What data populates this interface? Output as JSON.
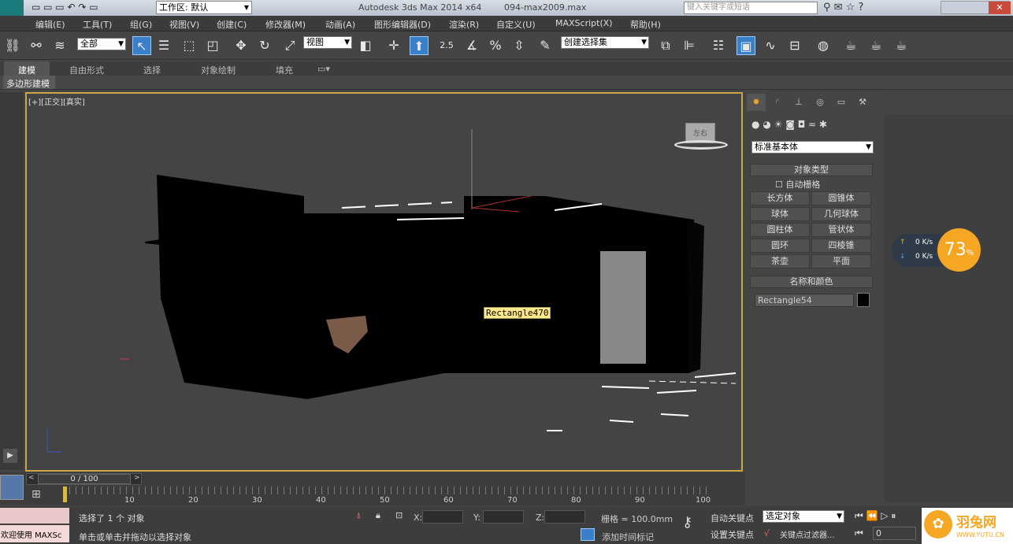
{
  "title": {
    "workspace": "工作区: 默认",
    "app": "Autodesk 3ds Max  2014 x64",
    "file": "094-max2009.max",
    "search_placeholder": "键入关键字或短语"
  },
  "menu": [
    "编辑(E)",
    "工具(T)",
    "组(G)",
    "视图(V)",
    "创建(C)",
    "修改器(M)",
    "动画(A)",
    "图形编辑器(D)",
    "渲染(R)",
    "自定义(U)",
    "MAXScript(X)",
    "帮助(H)"
  ],
  "toolbar": {
    "filter": "全部",
    "refcoord": "视图",
    "selset": "创建选择集",
    "angle_label": "2.5"
  },
  "ribbon": {
    "tabs": [
      "建模",
      "自由形式",
      "选择",
      "对象绘制",
      "填充"
    ],
    "sub": "多边形建模"
  },
  "viewport": {
    "label": "[+][正交][真实]",
    "tooltip": "Rectangle470",
    "viewcube": "左右"
  },
  "cmd": {
    "category": "标准基本体",
    "rollout1": "对象类型",
    "autogrid": "自动栅格",
    "buttons": [
      "长方体",
      "圆锥体",
      "球体",
      "几何球体",
      "圆柱体",
      "管状体",
      "圆环",
      "四棱锥",
      "茶壶",
      "平面"
    ],
    "rollout2": "名称和颜色",
    "name": "Rectangle54",
    "color": "#000000"
  },
  "net": {
    "up": "0 K/s",
    "down": "0 K/s",
    "percent": "73",
    "unit": "%"
  },
  "timeline": {
    "frame": "0 / 100",
    "ticks": [
      "10",
      "20",
      "30",
      "40",
      "50",
      "60",
      "70",
      "80",
      "90",
      "100"
    ]
  },
  "status": {
    "listener": "欢迎使用 MAXSc",
    "selected": "选择了 1 个 对象",
    "prompt": "单击或单击并拖动以选择对象",
    "x": "X:",
    "y": "Y:",
    "z": "Z:",
    "grid": "栅格 = 100.0mm",
    "autokey": "自动关键点",
    "setkey": "设置关键点",
    "keymode": "选定对象",
    "keyfilter": "关键点过滤器...",
    "addtime": "添加时间标记",
    "frame_field": "0"
  },
  "brand": {
    "name": "羽兔网",
    "url": "WWW.YUTU.CN",
    "color": "#f5a623"
  }
}
